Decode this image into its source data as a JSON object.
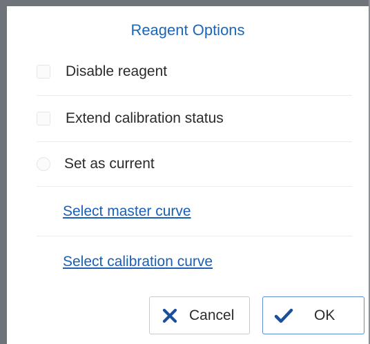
{
  "dialog": {
    "title": "Reagent Options"
  },
  "options": {
    "disable_reagent": {
      "label": "Disable reagent",
      "checked": false
    },
    "extend_calibration": {
      "label": "Extend calibration status",
      "checked": false
    },
    "set_as_current": {
      "label": "Set as current",
      "selected": false
    }
  },
  "links": {
    "master_curve": "Select master curve",
    "calibration_curve": "Select calibration curve"
  },
  "buttons": {
    "cancel_label": "Cancel",
    "ok_label": "OK"
  },
  "icons": {
    "cancel": "close-icon",
    "ok": "checkmark-icon"
  },
  "colors": {
    "title": "#1a66b8",
    "link": "#1a5fb4",
    "icon": "#1a4f9c",
    "frame": "#6f737a"
  }
}
